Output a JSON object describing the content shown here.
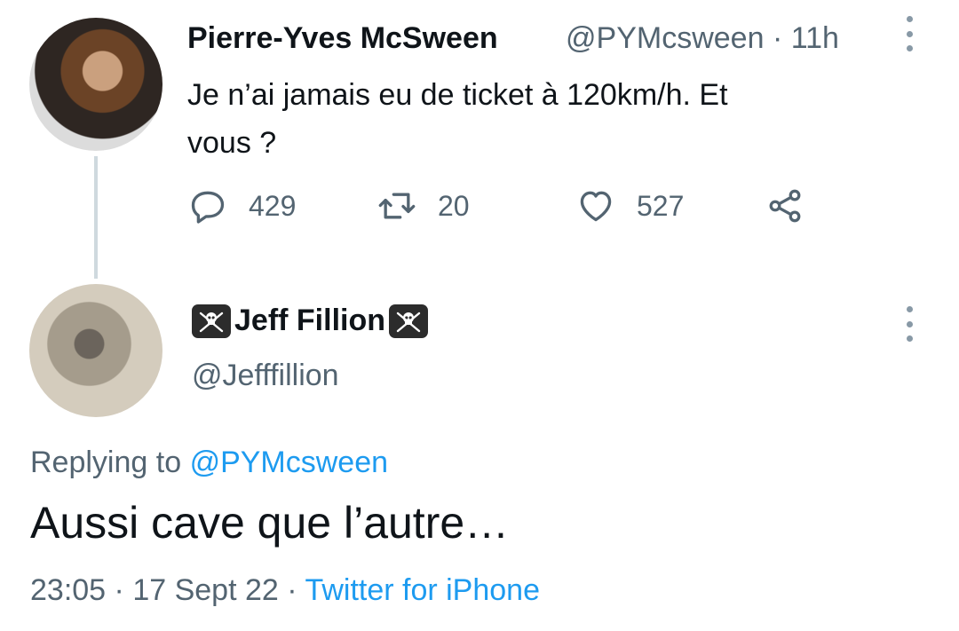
{
  "tweet1": {
    "author_name": "Pierre-Yves McSween",
    "handle": "@PYMcsween",
    "separator": "·",
    "time_ago": "11h",
    "text_line1": "Je n’ai jamais eu de ticket à 120km/h. Et",
    "text_line2": "vous ?",
    "actions": {
      "replies": "429",
      "retweets": "20",
      "likes": "527"
    }
  },
  "tweet2": {
    "author_name": "Jeff Fillion",
    "handle": "@Jefffillion",
    "replying_prefix": "Replying to",
    "replying_handle": "@PYMcsween",
    "text": "Aussi cave que l’autre…",
    "time": "23:05",
    "date": "17 Sept 22",
    "separator": "·",
    "source": "Twitter for iPhone"
  },
  "icons": {
    "reply": "reply-icon",
    "retweet": "retweet-icon",
    "like": "heart-icon",
    "share": "share-icon",
    "more": "more-dots-icon",
    "badge": "skull-crossbones-icon"
  },
  "colors": {
    "text": "#0f1419",
    "secondary": "#536471",
    "link": "#1d9bf0",
    "thread_line": "#cfd9de"
  }
}
